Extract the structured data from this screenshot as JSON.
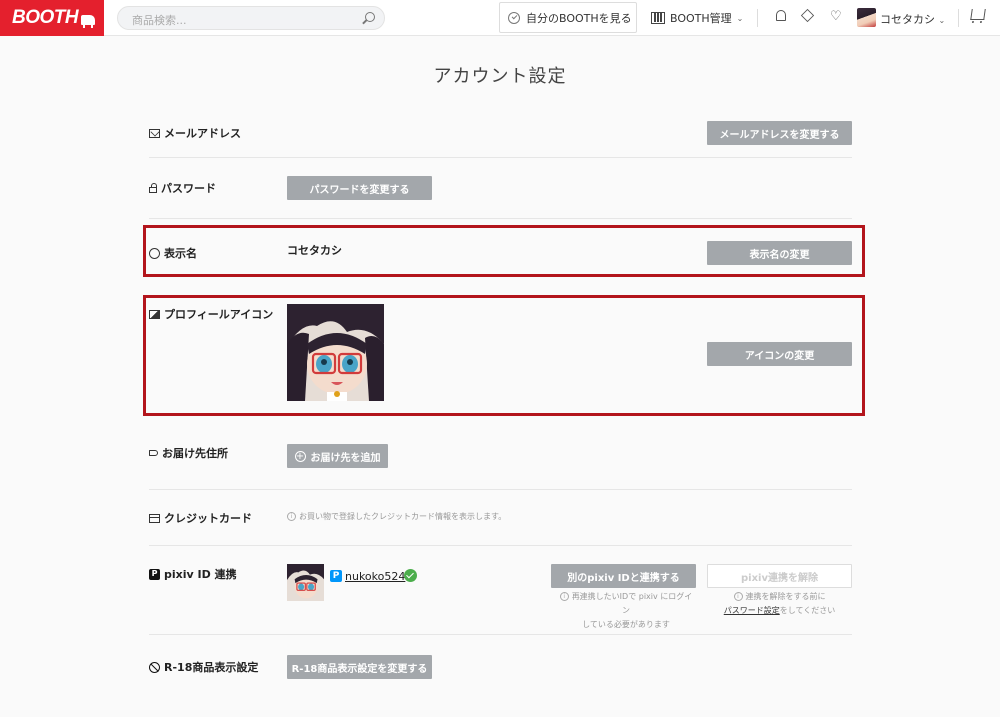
{
  "header": {
    "logo": "BOOTH",
    "search_placeholder": "商品検索...",
    "my_booth": "自分のBOOTHを見る",
    "manage": "BOOTH管理",
    "username": "コセタカシ"
  },
  "page": {
    "title": "アカウント設定"
  },
  "rows": {
    "email": {
      "label": "メールアドレス",
      "button": "メールアドレスを変更する"
    },
    "password": {
      "label": "パスワード",
      "button": "パスワードを変更する"
    },
    "display_name": {
      "label": "表示名",
      "value": "コセタカシ",
      "button": "表示名の変更"
    },
    "profile_icon": {
      "label": "プロフィールアイコン",
      "button": "アイコンの変更"
    },
    "address": {
      "label": "お届け先住所",
      "button": "お届け先を追加"
    },
    "credit_card": {
      "label": "クレジットカード",
      "note": "お買い物で登録したクレジットカード情報を表示します。"
    },
    "pixiv": {
      "label": "pixiv ID 連携",
      "account": "nukoko524",
      "link_button": "別のpixiv IDと連携する",
      "link_note_1": "再連携したいIDで pixiv にログイン",
      "link_note_2": "している必要があります",
      "unlink_button": "pixiv連携を解除",
      "unlink_note_1": "連携を解除をする前に",
      "unlink_note_link": "パスワード設定",
      "unlink_note_2": "をしてください"
    },
    "r18": {
      "label": "R-18商品表示設定",
      "button": "R-18商品表示設定を変更する"
    }
  },
  "colors": {
    "brand": "#e4202d",
    "button": "#a3a7ab",
    "highlight_box": "#b3151c",
    "pixiv_blue": "#0096fa",
    "verified": "#4cae4c"
  }
}
